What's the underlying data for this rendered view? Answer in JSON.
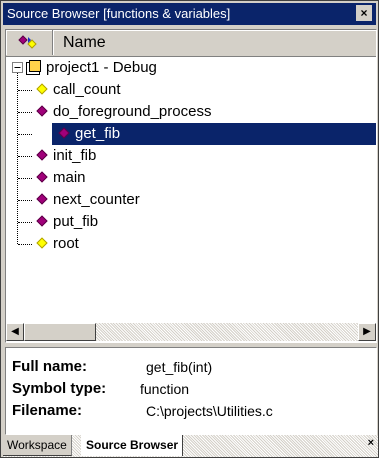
{
  "window": {
    "title": "Source Browser  [functions & variables]",
    "close_glyph": "×"
  },
  "header": {
    "name_label": "Name",
    "filter_icon": "symbol-filter-icon"
  },
  "tree": {
    "root_label": "project1 - Debug",
    "items": [
      {
        "label": "call_count",
        "kind": "variable",
        "color": "#ffff00",
        "selected": false
      },
      {
        "label": "do_foreground_process",
        "kind": "function",
        "color": "#a0007a",
        "selected": false
      },
      {
        "label": "get_fib",
        "kind": "function",
        "color": "#a0007a",
        "selected": true
      },
      {
        "label": "init_fib",
        "kind": "function",
        "color": "#a0007a",
        "selected": false
      },
      {
        "label": "main",
        "kind": "function",
        "color": "#a0007a",
        "selected": false
      },
      {
        "label": "next_counter",
        "kind": "function",
        "color": "#a0007a",
        "selected": false
      },
      {
        "label": "put_fib",
        "kind": "function",
        "color": "#a0007a",
        "selected": false
      },
      {
        "label": "root",
        "kind": "variable",
        "color": "#ffff00",
        "selected": false
      }
    ]
  },
  "scrollbar": {
    "left_arrow": "◀",
    "right_arrow": "▶"
  },
  "details": {
    "full_name_label": "Full name:",
    "full_name_value": "get_fib(int)",
    "symbol_type_label": "Symbol type:",
    "symbol_type_value": "function",
    "filename_label": "Filename:",
    "filename_value": "C:\\projects\\Utilities.c"
  },
  "tabs": {
    "workspace": "Workspace",
    "source_browser": "Source Browser",
    "close_glyph": "×"
  },
  "colors": {
    "selection": "#0a246a",
    "titlebar": "#0a246a",
    "function_icon": "#a0007a",
    "variable_icon": "#ffff00"
  }
}
